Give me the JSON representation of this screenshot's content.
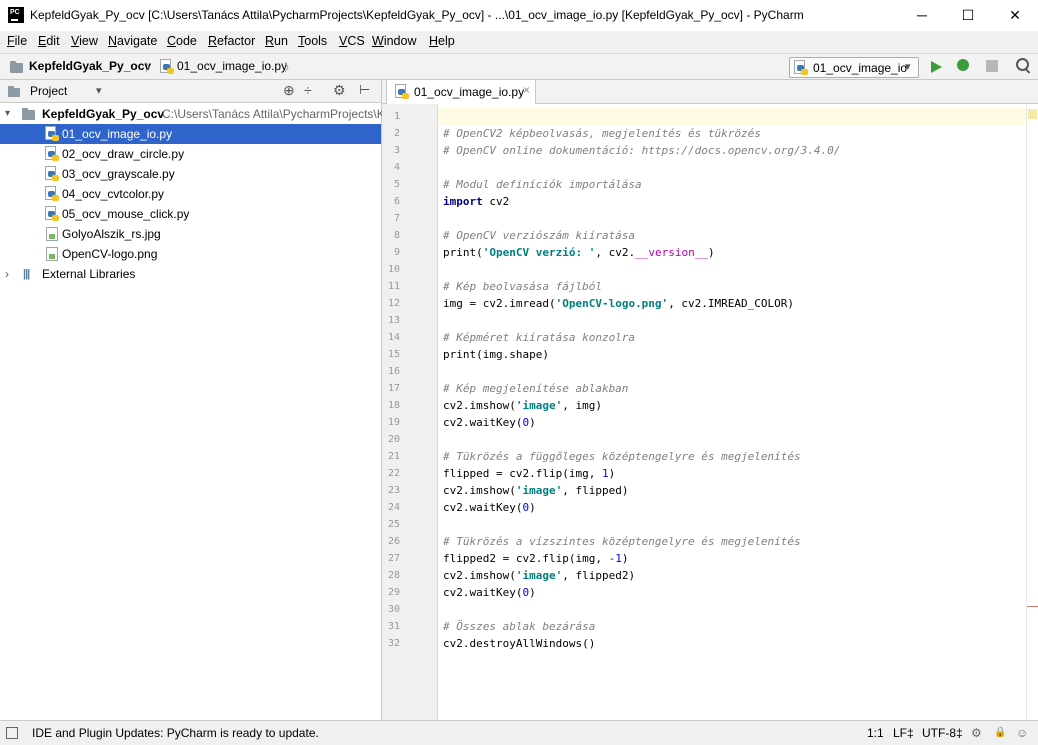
{
  "window": {
    "logo": "PC",
    "title": "KepfeldGyak_Py_ocv [C:\\Users\\Tanács Attila\\PycharmProjects\\KepfeldGyak_Py_ocv] - ...\\01_ocv_image_io.py [KepfeldGyak_Py_ocv] - PyCharm",
    "minimize": "─",
    "maximize": "☐",
    "close": "✕"
  },
  "menu": [
    {
      "u": "F",
      "rest": "ile"
    },
    {
      "u": "E",
      "rest": "dit"
    },
    {
      "u": "V",
      "rest": "iew"
    },
    {
      "u": "N",
      "rest": "avigate"
    },
    {
      "u": "C",
      "rest": "ode"
    },
    {
      "u": "R",
      "rest": "efactor"
    },
    {
      "u": "R",
      "rest": "un"
    },
    {
      "u": "T",
      "rest": "ools"
    },
    {
      "u": "V",
      "rest": "CS"
    },
    {
      "u": "W",
      "rest": "indow"
    },
    {
      "u": "H",
      "rest": "elp"
    }
  ],
  "breadcrumb": {
    "project": "KepfeldGyak_Py_ocv",
    "sep1": "〉",
    "file": "01_ocv_image_io.py",
    "sep2": "〉"
  },
  "run_config": {
    "label": "01_ocv_image_io",
    "arrow": "▾"
  },
  "project_panel": {
    "title": "Project",
    "arrow": "▾",
    "tools": [
      "⊕",
      "÷",
      "⚙",
      "⊢"
    ],
    "root": {
      "name": "KepfeldGyak_Py_ocv",
      "path": "C:\\Users\\Tanács Attila\\PycharmProjects\\K",
      "expander": "▾"
    },
    "files": [
      {
        "name": "01_ocv_image_io.py",
        "type": "py"
      },
      {
        "name": "02_ocv_draw_circle.py",
        "type": "py"
      },
      {
        "name": "03_ocv_grayscale.py",
        "type": "py"
      },
      {
        "name": "04_ocv_cvtcolor.py",
        "type": "py"
      },
      {
        "name": "05_ocv_mouse_click.py",
        "type": "py"
      },
      {
        "name": "GolyoAlszik_rs.jpg",
        "type": "img"
      },
      {
        "name": "OpenCV-logo.png",
        "type": "img"
      }
    ],
    "external": {
      "name": "External Libraries",
      "expander": "›",
      "icon": "|||"
    }
  },
  "editor": {
    "tab_label": "01_ocv_image_io.py",
    "tab_close": "×",
    "lines": [
      [],
      [
        [
          "cm",
          "# OpenCV2 képbeolvasás, megjelenítés és tükrözés"
        ]
      ],
      [
        [
          "cm",
          "# OpenCV online dokumentáció: https://docs.opencv.org/3.4.0/"
        ]
      ],
      [],
      [
        [
          "cm",
          "# Modul definíciók importálása"
        ]
      ],
      [
        [
          "kw",
          "import"
        ],
        [
          "",
          " cv2"
        ]
      ],
      [],
      [
        [
          "cm",
          "# OpenCV verziószám kiíratása"
        ]
      ],
      [
        [
          "",
          "print("
        ],
        [
          "st",
          "'OpenCV verzió: '"
        ],
        [
          "",
          ", cv2."
        ],
        [
          "dn",
          "__version__"
        ],
        [
          "",
          ")"
        ]
      ],
      [],
      [
        [
          "cm",
          "# Kép beolvasása fájlból"
        ]
      ],
      [
        [
          "",
          "img = cv2.imread("
        ],
        [
          "st",
          "'OpenCV-logo.png'"
        ],
        [
          "",
          ", cv2.IMREAD_COLOR)"
        ]
      ],
      [],
      [
        [
          "cm",
          "# Képméret kiíratása konzolra"
        ]
      ],
      [
        [
          "",
          "print(img.shape)"
        ]
      ],
      [],
      [
        [
          "cm",
          "# Kép megjelenítése ablakban"
        ]
      ],
      [
        [
          "",
          "cv2.imshow("
        ],
        [
          "st",
          "'image'"
        ],
        [
          "",
          ", img)"
        ]
      ],
      [
        [
          "",
          "cv2.waitKey("
        ],
        [
          "nm",
          "0"
        ],
        [
          "",
          ")"
        ]
      ],
      [],
      [
        [
          "cm",
          "# Tükrözés a függőleges középtengelyre és megjelenítés"
        ]
      ],
      [
        [
          "",
          "flipped = cv2.flip(img, "
        ],
        [
          "nm",
          "1"
        ],
        [
          "",
          ")"
        ]
      ],
      [
        [
          "",
          "cv2.imshow("
        ],
        [
          "st",
          "'image'"
        ],
        [
          "",
          ", flipped)"
        ]
      ],
      [
        [
          "",
          "cv2.waitKey("
        ],
        [
          "nm",
          "0"
        ],
        [
          "",
          ")"
        ]
      ],
      [],
      [
        [
          "cm",
          "# Tükrözés a vízszintes középtengelyre és megjelenítés"
        ]
      ],
      [
        [
          "",
          "flipped2 = cv2.flip(img, "
        ],
        [
          "nm",
          "-1"
        ],
        [
          "",
          ")"
        ]
      ],
      [
        [
          "",
          "cv2.imshow("
        ],
        [
          "st",
          "'image'"
        ],
        [
          "",
          ", flipped2)"
        ]
      ],
      [
        [
          "",
          "cv2.waitKey("
        ],
        [
          "nm",
          "0"
        ],
        [
          "",
          ")"
        ]
      ],
      [],
      [
        [
          "cm",
          "# Összes ablak bezárása"
        ]
      ],
      [
        [
          "",
          "cv2.destroyAllWindows()"
        ]
      ]
    ]
  },
  "status": {
    "message": "IDE and Plugin Updates: PyCharm is ready to update.",
    "position": "1:1",
    "line_sep": "LF‡",
    "encoding": "UTF-8‡",
    "icons": [
      "⚙",
      "🔒",
      "☺"
    ]
  },
  "colors": {
    "selection": "#2f65ca",
    "comment": "#808080",
    "keyword": "#000080",
    "string": "#008080",
    "dunder": "#b200b2",
    "number": "#0000ff",
    "run": "#3b9c3b"
  }
}
